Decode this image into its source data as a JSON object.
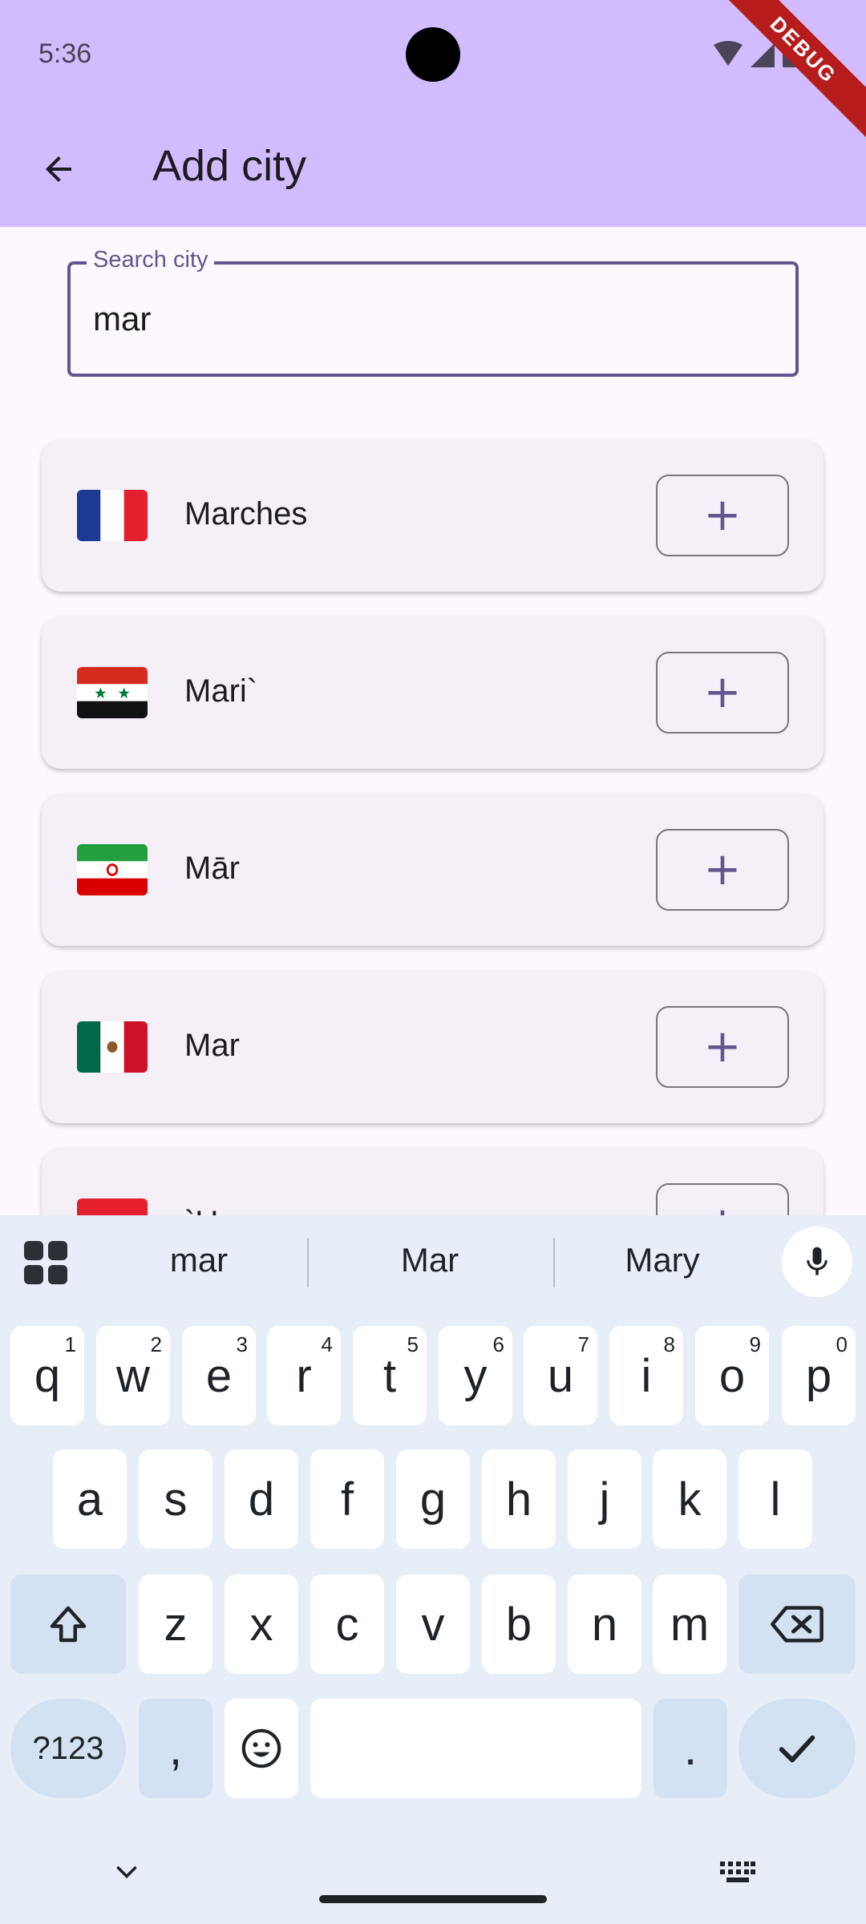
{
  "status_bar": {
    "time": "5:36",
    "debug_label": "DEBUG"
  },
  "app_bar": {
    "title": "Add city",
    "back_icon": "arrow-back-icon"
  },
  "search": {
    "label": "Search city",
    "value": "mar"
  },
  "cities": [
    {
      "name": "Marches",
      "flag": "france-flag",
      "add_icon": "plus-icon",
      "add_label": "+"
    },
    {
      "name": "Mari`",
      "flag": "syria-flag",
      "add_icon": "plus-icon",
      "add_label": "+"
    },
    {
      "name": "Mār",
      "flag": "iran-flag",
      "add_icon": "plus-icon",
      "add_label": "+"
    },
    {
      "name": "Mar",
      "flag": "mexico-flag",
      "add_icon": "plus-icon",
      "add_label": "+"
    },
    {
      "name": "`U",
      "flag": "red-white-flag",
      "add_icon": "plus-icon",
      "add_label": "+"
    }
  ],
  "keyboard": {
    "suggestions": [
      "mar",
      "Mar",
      "Mary"
    ],
    "row1": [
      "q",
      "w",
      "e",
      "r",
      "t",
      "y",
      "u",
      "i",
      "o",
      "p"
    ],
    "row1_hints": [
      "1",
      "2",
      "3",
      "4",
      "5",
      "6",
      "7",
      "8",
      "9",
      "0"
    ],
    "row2": [
      "a",
      "s",
      "d",
      "f",
      "g",
      "h",
      "j",
      "k",
      "l"
    ],
    "row3": [
      "z",
      "x",
      "c",
      "v",
      "b",
      "n",
      "m"
    ],
    "symbols_label": "?123",
    "comma": ",",
    "period": "."
  },
  "colors": {
    "app_bar": "#d0bcff",
    "primary": "#65558f",
    "card": "#f5eff7",
    "keyboard_bg": "#e8eef7",
    "special_key": "#d2e2f2"
  }
}
